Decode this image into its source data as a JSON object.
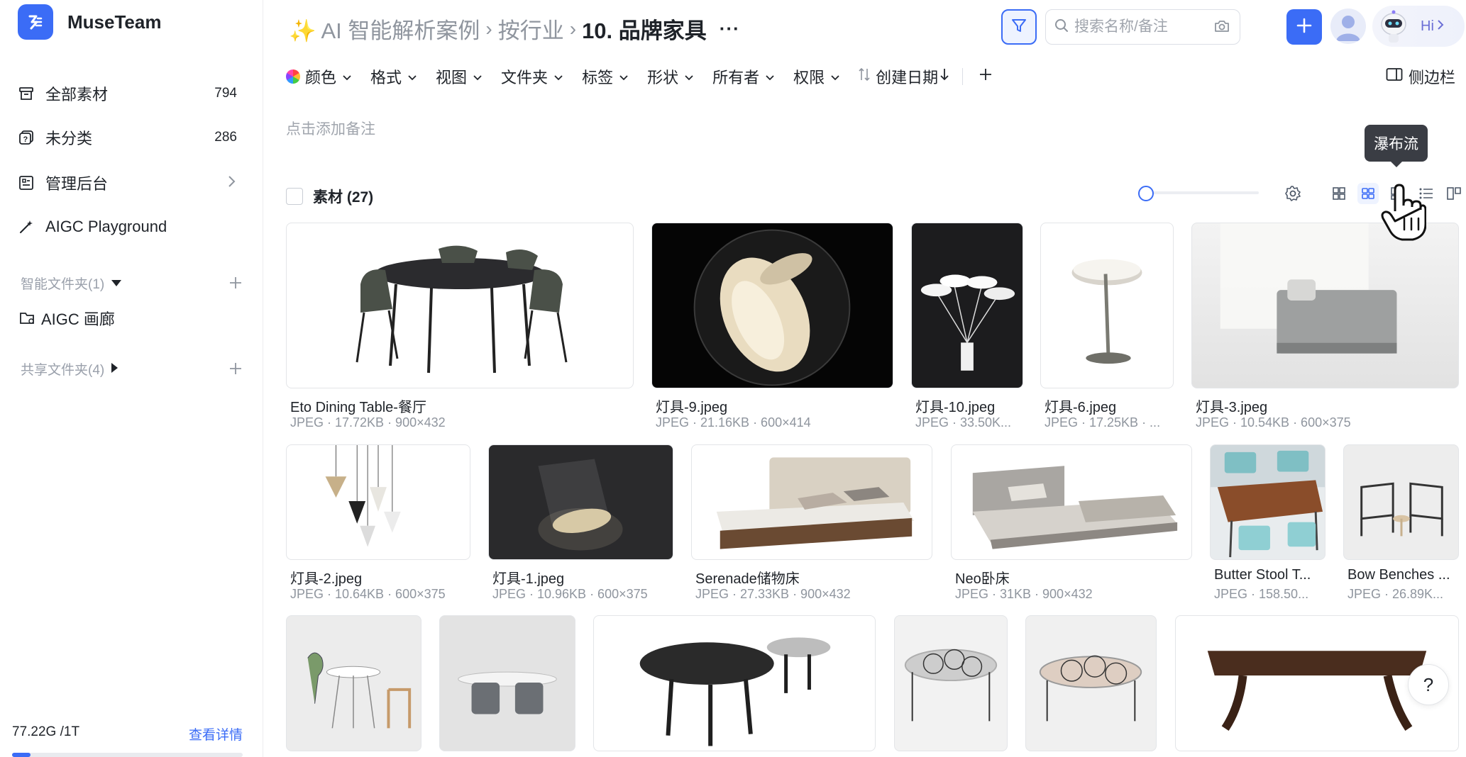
{
  "app": {
    "name": "MuseTeam"
  },
  "sidebar": {
    "items": [
      {
        "label": "全部素材",
        "count": "794"
      },
      {
        "label": "未分类",
        "count": "286"
      },
      {
        "label": "管理后台"
      },
      {
        "label": "AIGC Playground"
      }
    ],
    "smart_folders": {
      "title": "智能文件夹(1)",
      "items": [
        {
          "label": "AIGC 画廊"
        }
      ]
    },
    "shared_folders": {
      "title": "共享文件夹(4)"
    },
    "storage": {
      "used": "77.22G /1T",
      "detail": "查看详情",
      "fraction": 0.08
    }
  },
  "header": {
    "breadcrumb": {
      "root": "✨ AI 智能解析案例",
      "middle": "按行业",
      "current": "10. 品牌家具",
      "more": "···"
    },
    "search_placeholder": "搜索名称/备注",
    "hi": "Hi"
  },
  "toolbar": {
    "filters": [
      "颜色",
      "格式",
      "视图",
      "文件夹",
      "标签",
      "形状",
      "所有者",
      "权限"
    ],
    "sort": "创建日期",
    "sidebar_toggle": "侧边栏"
  },
  "note_placeholder": "点击添加备注",
  "grid": {
    "title": "素材 (27)",
    "tooltip": "瀑布流",
    "active_view": "瀑布流",
    "assets": [
      {
        "name": "Eto Dining Table-餐厅",
        "meta": "JPEG · 17.72KB · 900×432"
      },
      {
        "name": "灯具-9.jpeg",
        "meta": "JPEG · 21.16KB · 600×414"
      },
      {
        "name": "灯具-10.jpeg",
        "meta": "JPEG · 33.50K..."
      },
      {
        "name": "灯具-6.jpeg",
        "meta": "JPEG · 17.25KB · ..."
      },
      {
        "name": "灯具-3.jpeg",
        "meta": "JPEG · 10.54KB · 600×375"
      },
      {
        "name": "灯具-2.jpeg",
        "meta": "JPEG · 10.64KB · 600×375"
      },
      {
        "name": "灯具-1.jpeg",
        "meta": "JPEG · 10.96KB · 600×375"
      },
      {
        "name": "Serenade储物床",
        "meta": "JPEG · 27.33KB · 900×432"
      },
      {
        "name": "Neo卧床",
        "meta": "JPEG · 31KB · 900×432"
      },
      {
        "name": "Butter Stool T...",
        "meta": "JPEG · 158.50..."
      },
      {
        "name": "Bow Benches ...",
        "meta": "JPEG · 26.89K..."
      }
    ]
  },
  "help": "?",
  "colors": {
    "accent": "#3b6cf6",
    "muted": "#8f959e"
  }
}
